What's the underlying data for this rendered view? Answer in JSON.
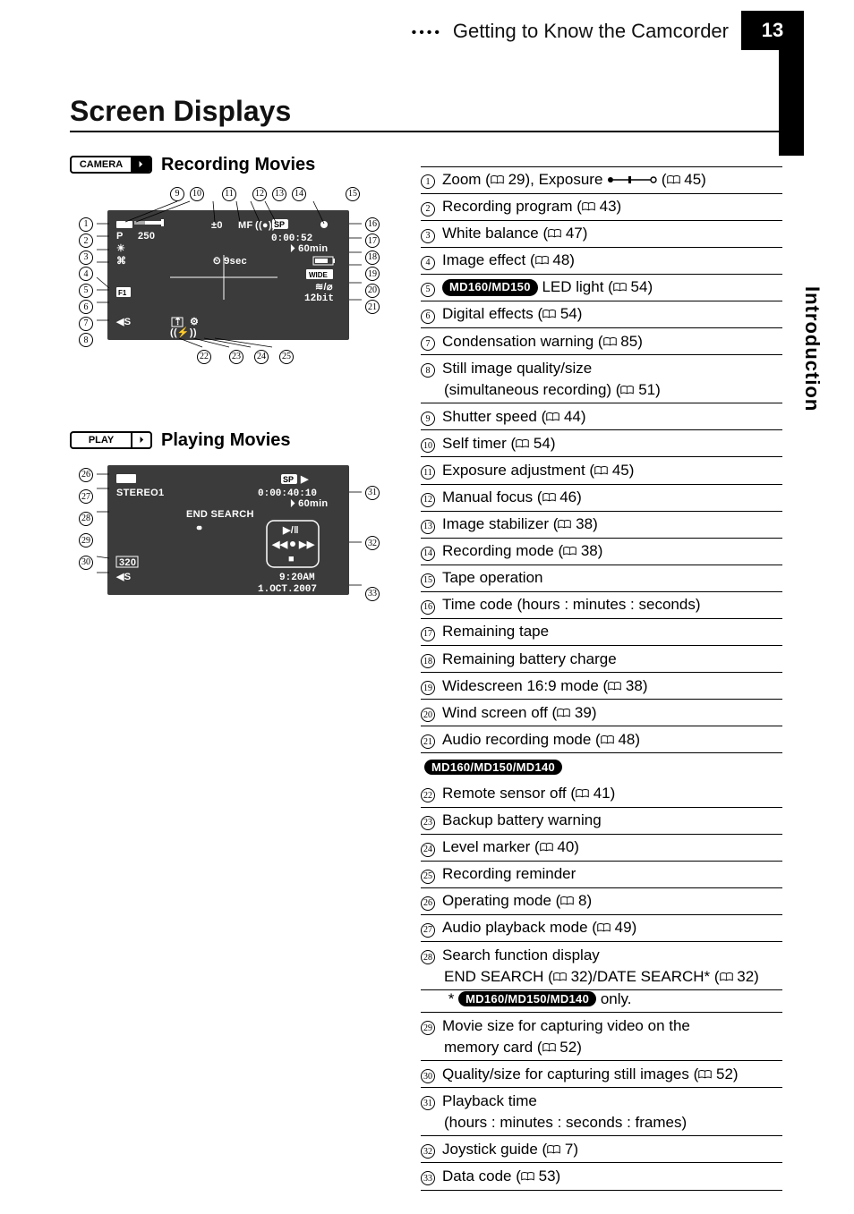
{
  "header": {
    "section": "Getting to Know the Camcorder",
    "page_number": "13"
  },
  "side_label": "Introduction",
  "page_title": "Screen Displays",
  "rec_movies_heading": "Recording Movies",
  "play_movies_heading": "Playing Movies",
  "badges": {
    "camera": "CAMERA",
    "play": "PLAY",
    "tape_icon": "⏵"
  },
  "osd1": {
    "p": "P",
    "shutter": "250",
    "pm": "±0",
    "mf": "MF",
    "stab": "((●))",
    "sp": "SP",
    "timecode": "0:00:52",
    "remaining": "⏵ 60min",
    "self": "⏲ 9sec",
    "wide": "WIDE",
    "wind": "≋/⌀",
    "bit": "12bit",
    "4s": "◀S"
  },
  "osd2": {
    "mode_badge": "▶",
    "sp": "SP",
    "play": "▶",
    "stereo": "STEREO1",
    "timecode": "0:00:40:10",
    "remaining": "⏵ 60min",
    "end_search": "END SEARCH",
    "data_link": "⚭",
    "nav_play": "▶/ǁ",
    "nav_rew": "◀◀",
    "nav_ff": "▶▶",
    "nav_stop": "■",
    "size": "320",
    "4s": "◀S",
    "time": "9:20AM",
    "date": "1.OCT.2007"
  },
  "callout_groups": {
    "screen1_top": [
      "9",
      "10",
      "11",
      "12",
      "13",
      "14",
      "15"
    ],
    "screen1_left": [
      "1",
      "2",
      "3",
      "4",
      "5",
      "6",
      "7",
      "8"
    ],
    "screen1_right": [
      "16",
      "17",
      "18",
      "19",
      "20",
      "21"
    ],
    "screen1_bottom": [
      "22",
      "23",
      "24",
      "25"
    ],
    "screen2_left": [
      "26",
      "27",
      "28",
      "29",
      "30"
    ],
    "screen2_right": [
      "31",
      "32",
      "33"
    ]
  },
  "items": [
    {
      "n": "1",
      "pre": "Zoom (",
      "ref": "29",
      "post": "), Exposure ",
      "exposure_icon": true,
      "post2": " (",
      "ref2": "45",
      "post3": ")"
    },
    {
      "n": "2",
      "pre": "Recording program (",
      "ref": "43",
      "post": ")"
    },
    {
      "n": "3",
      "pre": "White balance (",
      "ref": "47",
      "post": ")"
    },
    {
      "n": "4",
      "pre": "Image effect (",
      "ref": "48",
      "post": ")"
    },
    {
      "n": "5",
      "pill": "MD160/MD150",
      "pre2": " LED light (",
      "ref": "54",
      "post": ")"
    },
    {
      "n": "6",
      "pre": "Digital effects (",
      "ref": "54",
      "post": ")"
    },
    {
      "n": "7",
      "pre": "Condensation warning (",
      "ref": "85",
      "post": ")"
    },
    {
      "n": "8",
      "pre": "Still image quality/size",
      "sub": "(simultaneous recording) (",
      "subref": "51",
      "subpost": ")"
    },
    {
      "n": "9",
      "pre": "Shutter speed (",
      "ref": "44",
      "post": ")"
    },
    {
      "n": "10",
      "pre": "Self timer (",
      "ref": "54",
      "post": ")"
    },
    {
      "n": "11",
      "pre": "Exposure adjustment (",
      "ref": "45",
      "post": ")"
    },
    {
      "n": "12",
      "pre": "Manual focus (",
      "ref": "46",
      "post": ")"
    },
    {
      "n": "13",
      "pre": "Image stabilizer (",
      "ref": "38",
      "post": ")"
    },
    {
      "n": "14",
      "pre": "Recording mode (",
      "ref": "38",
      "post": ")"
    },
    {
      "n": "15",
      "pre": "Tape operation"
    },
    {
      "n": "16",
      "pre": "Time code (hours : minutes : seconds)"
    },
    {
      "n": "17",
      "pre": "Remaining tape"
    },
    {
      "n": "18",
      "pre": "Remaining battery charge"
    },
    {
      "n": "19",
      "pre": "Widescreen 16:9 mode (",
      "ref": "38",
      "post": ")"
    },
    {
      "n": "20",
      "pre": "Wind screen off (",
      "ref": "39",
      "post": ")"
    },
    {
      "n": "21",
      "pre": "Audio recording mode (",
      "ref": "48",
      "post": ")",
      "group_pill": "MD160/MD150/MD140"
    },
    {
      "n": "22",
      "pre": "Remote sensor off (",
      "ref": "41",
      "post": ")"
    },
    {
      "n": "23",
      "pre": "Backup battery warning"
    },
    {
      "n": "24",
      "pre": "Level marker (",
      "ref": "40",
      "post": ")"
    },
    {
      "n": "25",
      "pre": "Recording reminder"
    },
    {
      "n": "26",
      "pre": "Operating mode (",
      "ref": "8",
      "post": ")"
    },
    {
      "n": "27",
      "pre": "Audio playback mode (",
      "ref": "49",
      "post": ")"
    },
    {
      "n": "28",
      "pre": "Search function display",
      "sub": "END SEARCH (",
      "subref": "32",
      "subpost": ")/DATE SEARCH* (",
      "subref2": "32",
      "subpost2": ")",
      "note_star": "*",
      "note_pill": "MD160/MD150/MD140",
      "note_post": " only."
    },
    {
      "n": "29",
      "pre": "Movie size for capturing video on the ",
      "sub_plain": "memory card (",
      "subref": "52",
      "subpost": ")"
    },
    {
      "n": "30",
      "pre": "Quality/size for capturing still images (",
      "ref": "52",
      "post": ")"
    },
    {
      "n": "31",
      "pre": "Playback time",
      "sub_plain2": "(hours : minutes : seconds : frames)"
    },
    {
      "n": "32",
      "pre": "Joystick guide (",
      "ref": "7",
      "post": ")"
    },
    {
      "n": "33",
      "pre": "Data code (",
      "ref": "53",
      "post": ")"
    }
  ]
}
